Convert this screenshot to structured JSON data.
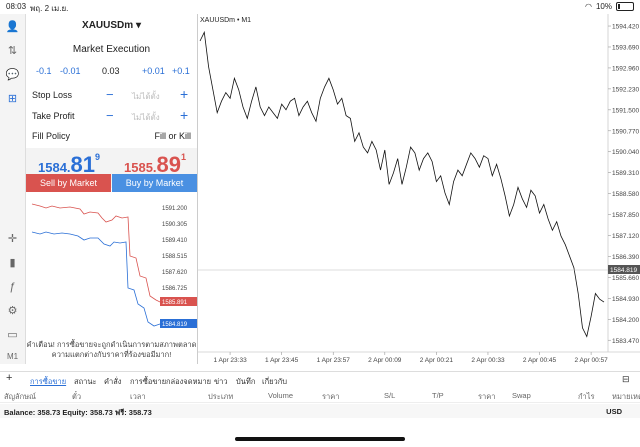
{
  "status": {
    "time": "08:03",
    "date": "พฤ. 2 เม.ย.",
    "battery": "10%"
  },
  "order": {
    "symbol": "XAUUSDm",
    "execution": "Market Execution",
    "volume": {
      "m01": "-0.1",
      "m001": "-0.01",
      "value": "0.03",
      "p001": "+0.01",
      "p01": "+0.1"
    },
    "stop_loss": {
      "label": "Stop Loss",
      "value": "ไม่ได้ตั้ง"
    },
    "take_profit": {
      "label": "Take Profit",
      "value": "ไม่ได้ตั้ง"
    },
    "fill_policy": {
      "label": "Fill Policy",
      "value": "Fill or Kill"
    },
    "bid": {
      "main": "1584.",
      "big": "81",
      "sup": "9"
    },
    "ask": {
      "main": "1585.",
      "big": "89",
      "sup": "1"
    },
    "sell_button": "Sell by Market",
    "buy_button": "Buy by Market",
    "mini_ticks": [
      "1591.200",
      "1590.305",
      "1589.410",
      "1588.515",
      "1587.620",
      "1586.725"
    ],
    "mini_ask_tag": "1585.891",
    "mini_bid_tag": "1584.819",
    "warning": "คำเตือน! การซื้อขายจะถูกดำเนินการตามสภาพตลาด ความแตกต่างกับราคาที่ร้องขอมีมาก!"
  },
  "chart": {
    "title": "XAUUSDm • M1",
    "y_ticks": [
      "1594.420",
      "1593.690",
      "1592.960",
      "1592.230",
      "1591.500",
      "1590.770",
      "1590.040",
      "1589.310",
      "1588.580",
      "1587.850",
      "1587.120",
      "1586.390",
      "1585.660",
      "1584.930",
      "1584.200",
      "1583.470"
    ],
    "x_ticks": [
      "1 Apr 23:33",
      "1 Apr 23:45",
      "1 Apr 23:57",
      "2 Apr 00:09",
      "2 Apr 00:21",
      "2 Apr 00:33",
      "2 Apr 00:45",
      "2 Apr 00:57"
    ],
    "current_tag": "1584.819"
  },
  "chart_data": {
    "type": "line",
    "title": "XAUUSDm • M1",
    "xlabel": "",
    "ylabel": "",
    "ylim": [
      1583.2,
      1594.7
    ],
    "x": [
      "1 Apr 23:26",
      "23:27",
      "23:28",
      "23:29",
      "23:30",
      "23:31",
      "23:32",
      "23:33",
      "23:34",
      "23:35",
      "23:36",
      "23:37",
      "23:38",
      "23:39",
      "23:40",
      "23:41",
      "23:42",
      "23:43",
      "23:44",
      "23:45",
      "23:46",
      "23:47",
      "23:48",
      "23:49",
      "23:50",
      "23:51",
      "23:52",
      "23:53",
      "23:54",
      "23:55",
      "23:56",
      "23:57",
      "23:58",
      "23:59",
      "2 Apr 00:00",
      "00:01",
      "00:02",
      "00:03",
      "00:04",
      "00:05",
      "00:06",
      "00:07",
      "00:08",
      "00:09",
      "00:10",
      "00:11",
      "00:12",
      "00:13",
      "00:14",
      "00:15",
      "00:16",
      "00:17",
      "00:18",
      "00:19",
      "00:20",
      "00:21",
      "00:22",
      "00:23",
      "00:24",
      "00:25",
      "00:26",
      "00:27",
      "00:28",
      "00:29",
      "00:30",
      "00:31",
      "00:32",
      "00:33",
      "00:34",
      "00:35",
      "00:36",
      "00:37",
      "00:38",
      "00:39",
      "00:40",
      "00:41",
      "00:42",
      "00:43",
      "00:44",
      "00:45",
      "00:46",
      "00:47",
      "00:48",
      "00:49",
      "00:50",
      "00:51",
      "00:52",
      "00:53",
      "00:54",
      "00:55",
      "00:56",
      "00:57",
      "00:58",
      "00:59"
    ],
    "values": [
      1593.9,
      1594.2,
      1593.0,
      1592.2,
      1591.4,
      1591.8,
      1592.1,
      1591.9,
      1592.6,
      1592.2,
      1591.6,
      1591.2,
      1591.8,
      1592.3,
      1591.6,
      1591.3,
      1591.6,
      1591.4,
      1591.2,
      1591.7,
      1591.5,
      1591.8,
      1591.9,
      1591.3,
      1591.6,
      1591.8,
      1591.4,
      1591.1,
      1591.9,
      1592.3,
      1592.6,
      1592.2,
      1591.7,
      1591.9,
      1591.3,
      1591.2,
      1590.4,
      1590.7,
      1590.2,
      1590.0,
      1590.4,
      1590.1,
      1589.4,
      1590.1,
      1588.9,
      1589.3,
      1589.8,
      1588.9,
      1589.5,
      1590.2,
      1590.0,
      1589.4,
      1589.8,
      1590.0,
      1589.7,
      1589.0,
      1589.2,
      1588.6,
      1588.2,
      1589.0,
      1589.4,
      1589.2,
      1589.6,
      1590.0,
      1589.8,
      1589.5,
      1589.9,
      1589.8,
      1589.2,
      1589.6,
      1589.1,
      1588.5,
      1587.8,
      1588.2,
      1588.8,
      1588.4,
      1588.1,
      1588.7,
      1588.5,
      1587.9,
      1588.2,
      1587.7,
      1587.3,
      1587.6,
      1587.1,
      1586.8,
      1586.4,
      1586.0,
      1585.1,
      1583.9,
      1583.6,
      1584.3,
      1585.1,
      1584.9,
      1584.8
    ]
  }
}
